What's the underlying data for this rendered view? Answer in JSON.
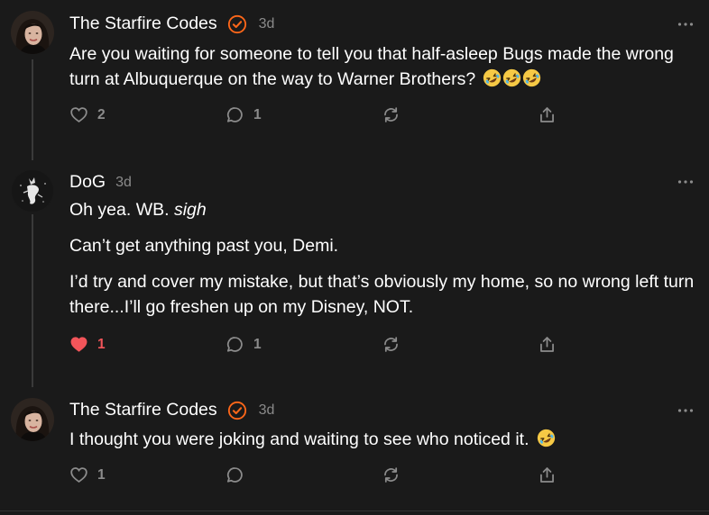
{
  "comments": [
    {
      "author": "The Starfire Codes",
      "time": "3d",
      "verified": true,
      "paragraphs": [
        "Are you waiting for someone to tell you that half-asleep Bugs made the wrong turn at Albuquerque on the way to Warner Brothers?"
      ],
      "trailing_emoji": [
        "rolling-on-floor-laughing",
        "rolling-on-floor-laughing",
        "rolling-on-floor-laughing"
      ],
      "likes": "2",
      "liked": false,
      "replies": "1"
    },
    {
      "author": "DoG",
      "time": "3d",
      "verified": false,
      "line1_text": "Oh yea. WB. ",
      "line1_em": "sigh",
      "paragraphs": [
        "Can’t get anything past you, Demi.",
        "I’d try and cover my mistake, but that’s obviously my home, so no wrong left turn there...I’ll go freshen up on my Disney, NOT."
      ],
      "likes": "1",
      "liked": true,
      "replies": "1"
    },
    {
      "author": "The Starfire Codes",
      "time": "3d",
      "verified": true,
      "paragraphs": [
        "I thought you were joking and waiting to see who noticed it."
      ],
      "trailing_emoji": [
        "rolling-on-floor-laughing"
      ],
      "likes": "1",
      "liked": false,
      "replies": ""
    }
  ],
  "colors": {
    "verified": "#ff6719",
    "liked": "#f2555a",
    "muted": "#8a8a8a",
    "background": "#1a1a1a"
  }
}
